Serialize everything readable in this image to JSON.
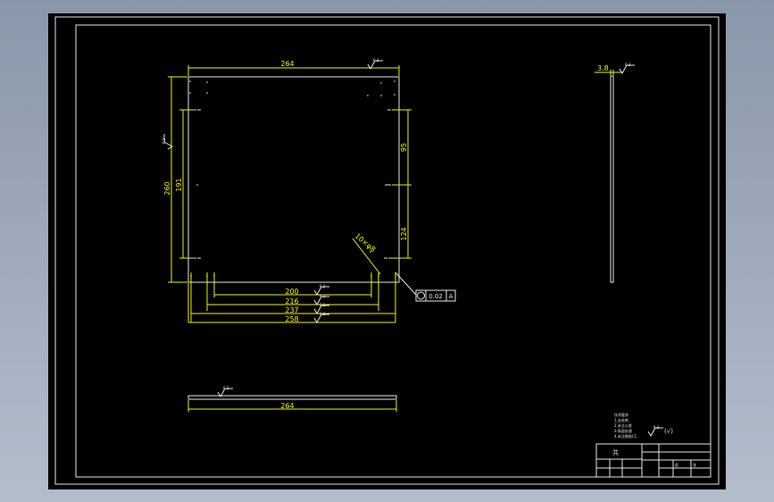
{
  "drawing": {
    "plan_dimensions": {
      "top_width": "264",
      "dim_200": "200",
      "dim_216": "216",
      "dim_237": "237",
      "dim_258": "258",
      "left_height": "260",
      "left_inner": "191",
      "right_upper": "95",
      "right_lower": "124",
      "hole_callout": "10×φ8"
    },
    "surface_finish": "6.3",
    "tolerance_frame": {
      "value": "0.02",
      "datum": "A"
    },
    "side_view": {
      "thickness": "3.8"
    },
    "bottom_view": {
      "width": "264"
    },
    "title_block": {
      "small_char": "共",
      "char_2": "此",
      "char_3": "张"
    },
    "notes": [
      "技术要求",
      "1.去毛刺",
      "2.未注公差",
      "3.表面处理",
      "4.未注倒角C1"
    ]
  }
}
